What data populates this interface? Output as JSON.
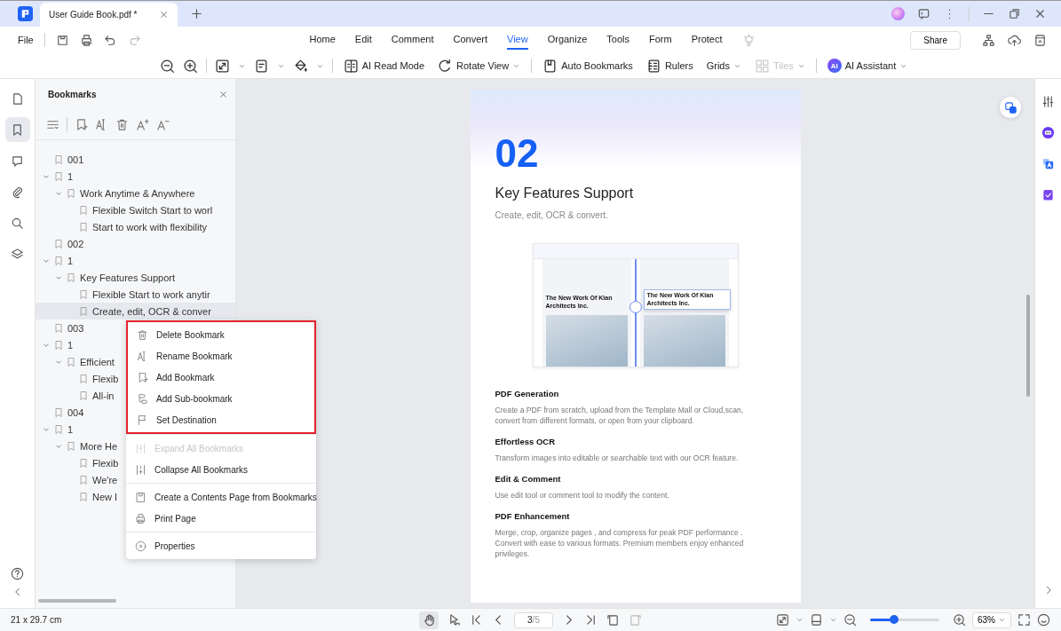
{
  "window": {
    "tab_title": "User Guide Book.pdf *"
  },
  "menu": {
    "file": "File",
    "tabs": [
      {
        "label": "Home",
        "selected": false
      },
      {
        "label": "Edit",
        "selected": false
      },
      {
        "label": "Comment",
        "selected": false
      },
      {
        "label": "Convert",
        "selected": false
      },
      {
        "label": "View",
        "selected": true
      },
      {
        "label": "Organize",
        "selected": false
      },
      {
        "label": "Tools",
        "selected": false
      },
      {
        "label": "Form",
        "selected": false
      },
      {
        "label": "Protect",
        "selected": false
      }
    ],
    "share": "Share"
  },
  "toolbar": [
    {
      "label": "AI Read Mode",
      "disabled": false
    },
    {
      "label": "Rotate View",
      "disabled": false
    },
    {
      "label": "Auto Bookmarks",
      "disabled": false
    },
    {
      "label": "Rulers",
      "disabled": false
    },
    {
      "label": "Grids",
      "disabled": false
    },
    {
      "label": "Tiles",
      "disabled": true
    }
  ],
  "ai_assistant": {
    "badge": "AI",
    "label": "AI Assistant"
  },
  "left_rail": [
    {
      "selected": false
    },
    {
      "selected": true
    },
    {
      "selected": false
    },
    {
      "selected": false
    },
    {
      "selected": false
    },
    {
      "selected": false
    }
  ],
  "bookmarks_panel": {
    "title": "Bookmarks",
    "items": [
      {
        "label": "001",
        "selected": false
      },
      {
        "label": "1",
        "selected": false,
        "expanded": true,
        "children": [
          {
            "label": "Work Anytime & Anywhere",
            "selected": false,
            "expanded": true,
            "children": [
              {
                "label": "Flexible Switch Start to worl",
                "selected": false
              },
              {
                "label": "Start to work with flexibility",
                "selected": false
              }
            ]
          }
        ]
      },
      {
        "label": "002",
        "selected": false
      },
      {
        "label": "1",
        "selected": false,
        "expanded": true,
        "children": [
          {
            "label": "Key Features Support",
            "selected": false,
            "expanded": true,
            "children": [
              {
                "label": "Flexible Start to work anytir",
                "selected": false
              },
              {
                "label": "Create, edit, OCR & conver",
                "selected": true
              }
            ]
          }
        ]
      },
      {
        "label": "003",
        "selected": false
      },
      {
        "label": "1",
        "selected": false,
        "expanded": true,
        "children": [
          {
            "label": "Efficient",
            "selected": false,
            "expanded": true,
            "children": [
              {
                "label": "Flexib",
                "selected": false
              },
              {
                "label": "All-in",
                "selected": false
              }
            ]
          }
        ]
      },
      {
        "label": "004",
        "selected": false
      },
      {
        "label": "1",
        "selected": false,
        "expanded": true,
        "children": [
          {
            "label": "More He",
            "selected": false,
            "expanded": true,
            "children": [
              {
                "label": "Flexib",
                "selected": false
              },
              {
                "label": "We're",
                "selected": false
              },
              {
                "label": "New I",
                "selected": false
              }
            ]
          }
        ]
      }
    ]
  },
  "context_menu": {
    "highlighted": [
      {
        "label": "Delete Bookmark",
        "disabled": false
      },
      {
        "label": "Rename Bookmark",
        "disabled": false
      },
      {
        "label": "Add Bookmark",
        "disabled": false
      },
      {
        "label": "Add Sub-bookmark",
        "disabled": false
      },
      {
        "label": "Set Destination",
        "disabled": false
      }
    ],
    "groups": [
      [
        {
          "label": "Expand All Bookmarks",
          "disabled": true
        },
        {
          "label": "Collapse All Bookmarks",
          "disabled": false
        }
      ],
      [
        {
          "label": "Create a Contents Page from Bookmarks",
          "disabled": false
        },
        {
          "label": "Print Page",
          "disabled": false
        }
      ],
      [
        {
          "label": "Properties",
          "disabled": false
        }
      ]
    ]
  },
  "page": {
    "number": "02",
    "title": "Key Features Support",
    "subtitle": "Create, edit, OCR & convert.",
    "screenshot_captions": [
      "The New Work Of Klan Architects Inc.",
      "The New Work Of Klan Architects Inc."
    ],
    "sections": [
      {
        "heading": "PDF Generation",
        "body": "Create a PDF from scratch, upload from the Template Mall or Cloud,scan, convert from different formats, or open from your clipboard."
      },
      {
        "heading": "Effortless OCR",
        "body": "Transform images into editable or searchable text with our OCR feature."
      },
      {
        "heading": "Edit & Comment",
        "body": "Use edit tool or comment tool to modify the content."
      },
      {
        "heading": "PDF Enhancement",
        "body": "Merge, crop, organize pages , and compress for peak PDF performance . Convert with ease to various formats. Premium members enjoy enhanced privileges."
      }
    ]
  },
  "status_bar": {
    "page_size": "21 x 29.7 cm",
    "page_input": "3",
    "page_total": "/5",
    "zoom": {
      "level": 0.35
    },
    "zoom_value": "63%"
  }
}
